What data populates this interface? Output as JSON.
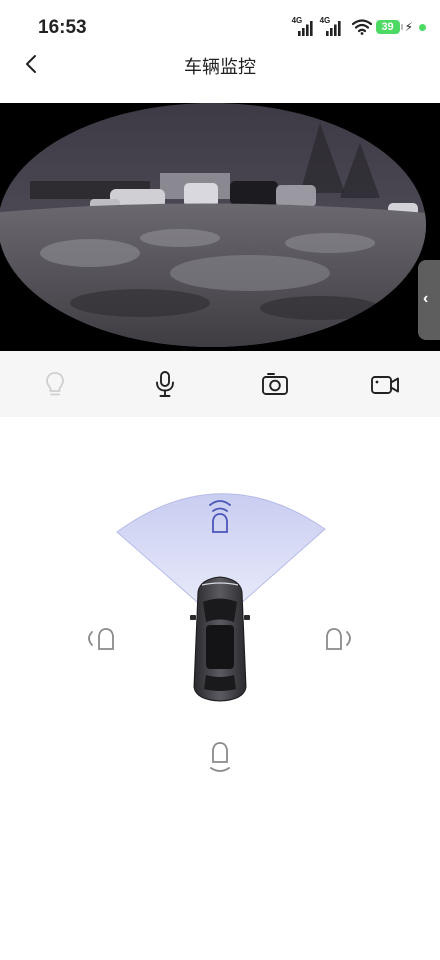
{
  "status": {
    "time": "16:53",
    "network_1": "4G",
    "network_2": "4G",
    "battery": "39",
    "charging_icon": "bolt-icon"
  },
  "nav": {
    "title": "车辆监控",
    "back_icon": "chevron-left-icon"
  },
  "camera": {
    "expand_icon": "chevron-left-icon",
    "mode": "fisheye-live-feed"
  },
  "toolbar": {
    "items": [
      {
        "name": "light",
        "icon": "lightbulb-icon",
        "enabled": false
      },
      {
        "name": "microphone",
        "icon": "microphone-icon",
        "enabled": true
      },
      {
        "name": "snapshot",
        "icon": "camera-icon",
        "enabled": true
      },
      {
        "name": "record",
        "icon": "video-camera-icon",
        "enabled": true
      }
    ]
  },
  "radar": {
    "active_direction": "front",
    "colors": {
      "active": "#4a55b8",
      "cone": "#c9cdf0",
      "inactive": "#8a8a8a"
    },
    "sensors": [
      "front",
      "left",
      "right",
      "rear"
    ]
  }
}
